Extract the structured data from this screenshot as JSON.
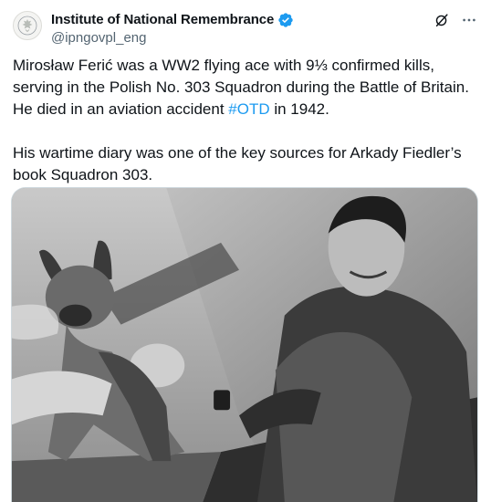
{
  "author": {
    "display_name": "Institute of National Remembrance",
    "handle": "@ipngovpl_eng",
    "verified": true,
    "avatar_icon": "eagle-crest-icon"
  },
  "actions": {
    "grok_icon": "grok-icon",
    "more_icon": "more-icon"
  },
  "tweet": {
    "paragraph1_before": "Mirosław Ferić was a WW2 flying ace with 9⅓ confirmed kills, serving in the Polish No. 303 Squadron during the Battle of Britain. He died in an aviation accident ",
    "hashtag": "#OTD",
    "paragraph1_after": " in 1942.",
    "paragraph2": "His wartime diary was one of the key sources for Arkady Fiedler’s book Squadron 303."
  },
  "media": {
    "type": "photo",
    "style": "black-and-white",
    "subject": "pilot-holding-puppy"
  },
  "colors": {
    "text": "#0f1419",
    "secondary": "#536471",
    "link": "#1d9bf0",
    "verified": "#1d9bf0"
  }
}
